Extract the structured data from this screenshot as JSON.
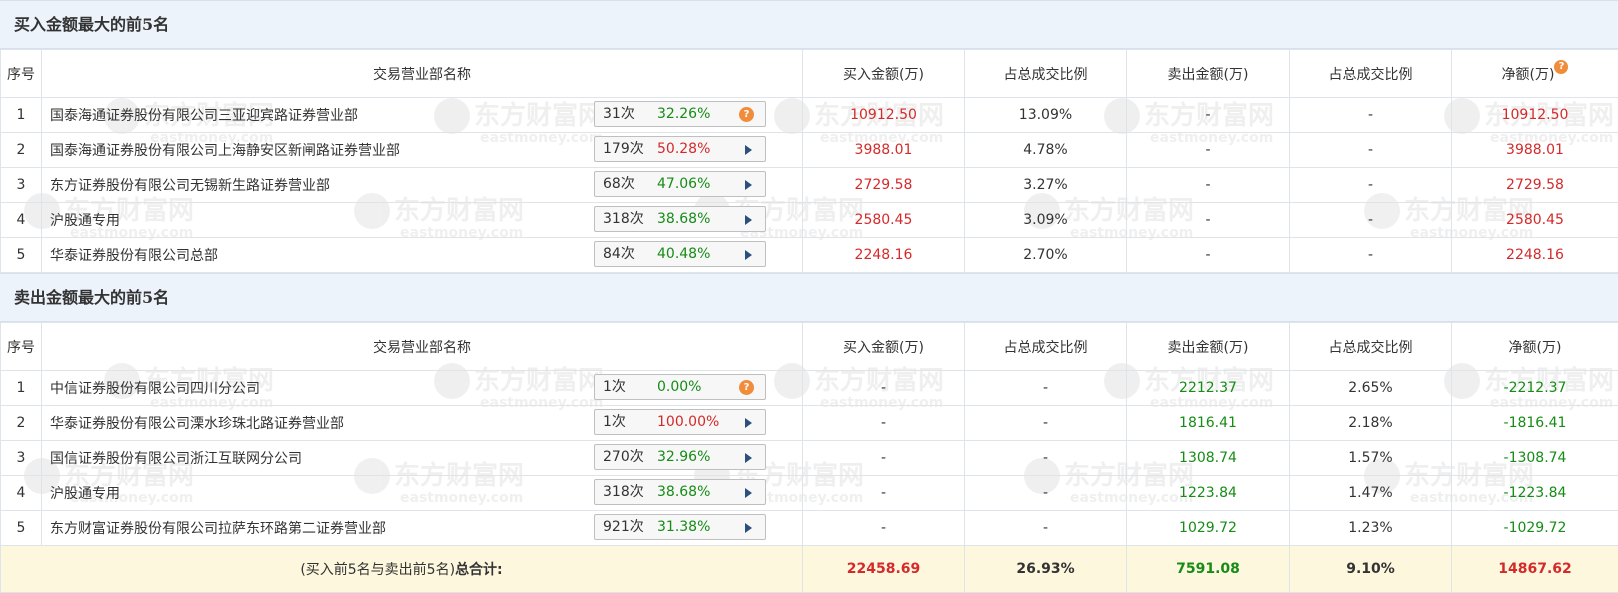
{
  "buy": {
    "title": "买入金额最大的前5名",
    "headers": {
      "seq": "序号",
      "name": "交易营业部名称",
      "buy": "买入金额(万)",
      "buy_pct": "占总成交比例",
      "sell": "卖出金额(万)",
      "sell_pct": "占总成交比例",
      "net": "净额(万)"
    },
    "rows": [
      {
        "seq": "1",
        "name": "国泰海通证券股份有限公司三亚迎宾路证券营业部",
        "count": "31次",
        "rate": "32.26%",
        "buy": "10912.50",
        "buy_pct": "13.09%",
        "sell": "-",
        "sell_pct": "-",
        "net": "10912.50",
        "icon": "question-icon"
      },
      {
        "seq": "2",
        "name": "国泰海通证券股份有限公司上海静安区新闸路证券营业部",
        "count": "179次",
        "rate": "50.28%",
        "buy": "3988.01",
        "buy_pct": "4.78%",
        "sell": "-",
        "sell_pct": "-",
        "net": "3988.01",
        "icon": "play-arrow-icon"
      },
      {
        "seq": "3",
        "name": "东方证券股份有限公司无锡新生路证券营业部",
        "count": "68次",
        "rate": "47.06%",
        "buy": "2729.58",
        "buy_pct": "3.27%",
        "sell": "-",
        "sell_pct": "-",
        "net": "2729.58",
        "icon": "play-arrow-icon"
      },
      {
        "seq": "4",
        "name": "沪股通专用",
        "count": "318次",
        "rate": "38.68%",
        "buy": "2580.45",
        "buy_pct": "3.09%",
        "sell": "-",
        "sell_pct": "-",
        "net": "2580.45",
        "icon": "play-arrow-icon"
      },
      {
        "seq": "5",
        "name": "华泰证券股份有限公司总部",
        "count": "84次",
        "rate": "40.48%",
        "buy": "2248.16",
        "buy_pct": "2.70%",
        "sell": "-",
        "sell_pct": "-",
        "net": "2248.16",
        "icon": "play-arrow-icon"
      }
    ]
  },
  "sell": {
    "title": "卖出金额最大的前5名",
    "headers": {
      "seq": "序号",
      "name": "交易营业部名称",
      "buy": "买入金额(万)",
      "buy_pct": "占总成交比例",
      "sell": "卖出金额(万)",
      "sell_pct": "占总成交比例",
      "net": "净额(万)"
    },
    "rows": [
      {
        "seq": "1",
        "name": "中信证券股份有限公司四川分公司",
        "count": "1次",
        "rate": "0.00%",
        "buy": "-",
        "buy_pct": "-",
        "sell": "2212.37",
        "sell_pct": "2.65%",
        "net": "-2212.37",
        "icon": "question-icon"
      },
      {
        "seq": "2",
        "name": "华泰证券股份有限公司溧水珍珠北路证券营业部",
        "count": "1次",
        "rate": "100.00%",
        "buy": "-",
        "buy_pct": "-",
        "sell": "1816.41",
        "sell_pct": "2.18%",
        "net": "-1816.41",
        "icon": "play-arrow-icon"
      },
      {
        "seq": "3",
        "name": "国信证券股份有限公司浙江互联网分公司",
        "count": "270次",
        "rate": "32.96%",
        "buy": "-",
        "buy_pct": "-",
        "sell": "1308.74",
        "sell_pct": "1.57%",
        "net": "-1308.74",
        "icon": "play-arrow-icon"
      },
      {
        "seq": "4",
        "name": "沪股通专用",
        "count": "318次",
        "rate": "38.68%",
        "buy": "-",
        "buy_pct": "-",
        "sell": "1223.84",
        "sell_pct": "1.47%",
        "net": "-1223.84",
        "icon": "play-arrow-icon"
      },
      {
        "seq": "5",
        "name": "东方财富证券股份有限公司拉萨东环路第二证券营业部",
        "count": "921次",
        "rate": "31.38%",
        "buy": "-",
        "buy_pct": "-",
        "sell": "1029.72",
        "sell_pct": "1.23%",
        "net": "-1029.72",
        "icon": "play-arrow-icon"
      }
    ]
  },
  "total": {
    "label_prefix": "(买入前5名与卖出前5名)",
    "label_bold": "总合计:",
    "buy": "22458.69",
    "buy_pct": "26.93%",
    "sell": "7591.08",
    "sell_pct": "9.10%",
    "net": "14867.62"
  },
  "watermark": {
    "cn": "东方财富网",
    "en": "eastmoney.com"
  },
  "colors": {
    "positive": "#d42a2a",
    "negative": "#168c16",
    "accent_icon": "#f08c3a",
    "arrow": "#2d4f7c",
    "total_bg": "#fdf7de",
    "title_bg": "#edf3fb"
  }
}
